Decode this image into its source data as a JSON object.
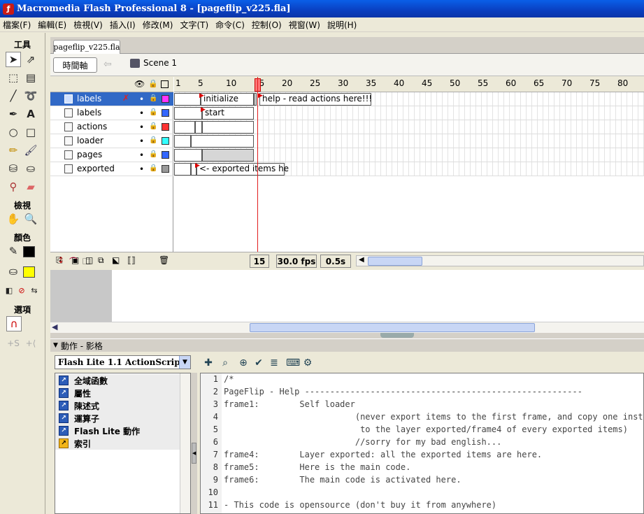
{
  "window": {
    "title": "Macromedia Flash Professional 8 - [pageflip_v225.fla]"
  },
  "menu": [
    "檔案(F)",
    "編輯(E)",
    "檢視(V)",
    "插入(I)",
    "修改(M)",
    "文字(T)",
    "命令(C)",
    "控制(O)",
    "視窗(W)",
    "說明(H)"
  ],
  "tools": {
    "title": "工具",
    "view_title": "檢視",
    "colors_title": "顏色",
    "options_title": "選項",
    "stroke_color": "#000000",
    "fill_color": "#ffff00"
  },
  "document": {
    "tab": "pageflip_v225.fla",
    "timeline_button": "時間軸",
    "scene": "Scene 1"
  },
  "timeline": {
    "ruler_ticks": [
      "1",
      "5",
      "10",
      "15",
      "20",
      "25",
      "30",
      "35",
      "40",
      "45",
      "50",
      "55",
      "60",
      "65",
      "70",
      "75",
      "80"
    ],
    "layers": [
      {
        "name": "labels",
        "color": "#ff33ff",
        "selected": true
      },
      {
        "name": "labels",
        "color": "#3366ff",
        "selected": false
      },
      {
        "name": "actions",
        "color": "#ff3333",
        "selected": false
      },
      {
        "name": "loader",
        "color": "#33ffff",
        "selected": false
      },
      {
        "name": "pages",
        "color": "#3366ff",
        "selected": false
      },
      {
        "name": "exported",
        "color": "#999999",
        "selected": false
      }
    ],
    "frame_labels": {
      "initialize": "initialize",
      "help": "help - read actions here!!!",
      "start": "start",
      "exported": "<- exported items he"
    },
    "current_frame": "15",
    "fps": "30.0 fps",
    "time": "0.5s"
  },
  "actions_panel": {
    "title": "動作 - 影格",
    "language": "Flash Lite 1.1 ActionScript",
    "tree": [
      {
        "label": "全域函數",
        "icon": "book-icon"
      },
      {
        "label": "屬性",
        "icon": "book-icon"
      },
      {
        "label": "陳述式",
        "icon": "book-icon"
      },
      {
        "label": "運算子",
        "icon": "book-icon"
      },
      {
        "label": "Flash Lite 動作",
        "icon": "book-icon"
      },
      {
        "label": "索引",
        "icon": "book-icon"
      }
    ],
    "code": [
      {
        "n": "1",
        "text": "/*"
      },
      {
        "n": "2",
        "text": "PageFlip - Help -------------------------------------------------------"
      },
      {
        "n": "3",
        "text": "frame1:        Self loader"
      },
      {
        "n": "4",
        "text": "                          (never export items to the first frame, and copy one instance"
      },
      {
        "n": "5",
        "text": "                           to the layer exported/frame4 of every exported items)"
      },
      {
        "n": "6",
        "text": "                          //sorry for my bad english..."
      },
      {
        "n": "7",
        "text": "frame4:        Layer exported: all the exported items are here."
      },
      {
        "n": "8",
        "text": "frame5:        Here is the main code."
      },
      {
        "n": "9",
        "text": "frame6:        The main code is activated here."
      },
      {
        "n": "10",
        "text": ""
      },
      {
        "n": "11",
        "text": "- This code is opensource (don't buy it from anywhere)"
      }
    ]
  }
}
